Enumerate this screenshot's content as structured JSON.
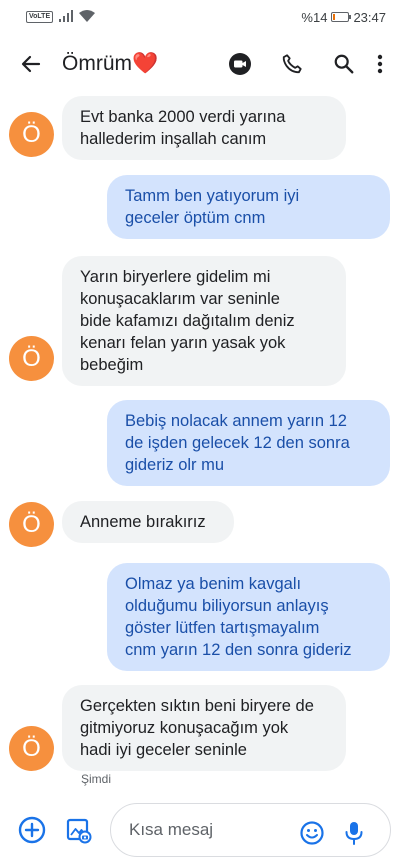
{
  "status_bar": {
    "network": "VoLTE",
    "battery_percent_label": "%14",
    "battery_level": 0.14,
    "time": "23:47"
  },
  "app_bar": {
    "contact_name": "Ömrüm❤️",
    "icons": [
      "back-arrow-icon",
      "video-call-icon",
      "phone-icon",
      "search-icon",
      "more-vert-icon"
    ]
  },
  "avatar_letter": "Ö",
  "messages": [
    {
      "direction": "in",
      "text": "Evt banka 2000 verdi yarına\nhallederim inşallah canım"
    },
    {
      "direction": "out",
      "text": "Tamm ben yatıyorum iyi\ngeceler öptüm cnm"
    },
    {
      "direction": "in",
      "text": "Yarın biryerlere gidelim mi\nkonuşacaklarım var seninle\nbide kafamızı dağıtalım deniz\nkenarı felan yarın yasak yok\nbebeğim"
    },
    {
      "direction": "out",
      "text": "Bebiş nolacak annem yarın 12\nde işden gelecek 12 den sonra\ngideriz olr mu"
    },
    {
      "direction": "in",
      "text": "Anneme bırakırız"
    },
    {
      "direction": "out",
      "text": "Olmaz ya benim kavgalı\nolduğumu biliyorsun anlayış\ngöster lütfen tartışmayalım\ncnm yarın 12 den sonra gideriz"
    },
    {
      "direction": "in",
      "text": "Gerçekten sıktın beni biryere de\ngitmiyoruz konuşacağım yok\nhadi iyi geceler seninle"
    }
  ],
  "last_timestamp": "Şimdi",
  "compose": {
    "placeholder": "Kısa mesaj",
    "icons": [
      "add-circle-icon",
      "gallery-icon",
      "emoji-icon",
      "mic-icon"
    ]
  },
  "colors": {
    "incoming_bubble": "#f1f3f4",
    "outgoing_bubble": "#d3e3fd",
    "outgoing_text": "#1a4fa8",
    "avatar": "#f6903e",
    "accent": "#1a73e8"
  }
}
